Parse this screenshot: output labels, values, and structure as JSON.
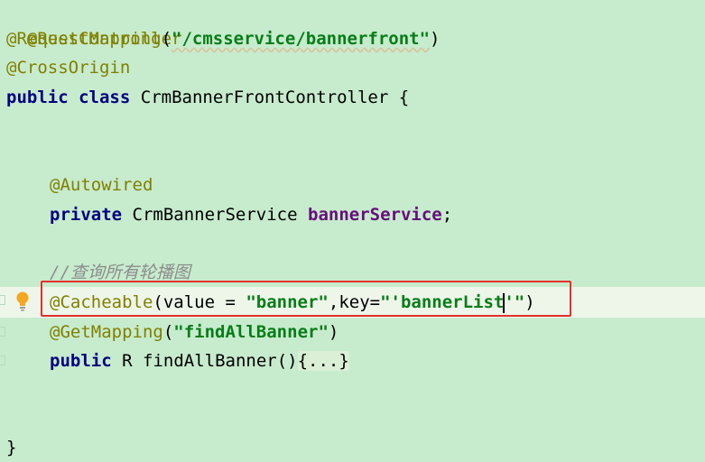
{
  "editor": {
    "lines": {
      "l1": {
        "ann": "@RestController"
      },
      "l2": {
        "ann": "@RequestMapping",
        "open": "(",
        "str": "\"/cmsservice/bannerfront\"",
        "close": ")"
      },
      "l3": {
        "ann": "@CrossOrigin"
      },
      "l4": {
        "kw1": "public",
        "kw2": "class",
        "name": "CrmBannerFrontController",
        "brace": "{"
      },
      "l5": {
        "ann": "@Autowired"
      },
      "l6": {
        "kw": "private",
        "type": "CrmBannerService",
        "field": "bannerService",
        "semi": ";"
      },
      "l7": {
        "comment": "//查询所有轮播图"
      },
      "l8": {
        "ann": "@Cacheable",
        "open": "(",
        "p1": "value = ",
        "s1": "\"banner\"",
        "p2": ",key=",
        "s2a": "\"'bannerList",
        "s2b": "'\"",
        "close": ")"
      },
      "l9": {
        "ann": "@GetMapping",
        "open": "(",
        "str": "\"findAllBanner\"",
        "close": ")"
      },
      "l10": {
        "kw": "public",
        "rtype": "R",
        "method": "findAllBanner",
        "parens": "()",
        "fold": "{...}"
      },
      "l11": {
        "brace": "}"
      }
    }
  },
  "colors": {
    "background": "#c7ebcd",
    "annotation": "#808000",
    "keyword": "#000080",
    "string": "#067d17",
    "field": "#660e7a",
    "comment": "#8c8c8c",
    "highlight_border": "#e3302f"
  }
}
